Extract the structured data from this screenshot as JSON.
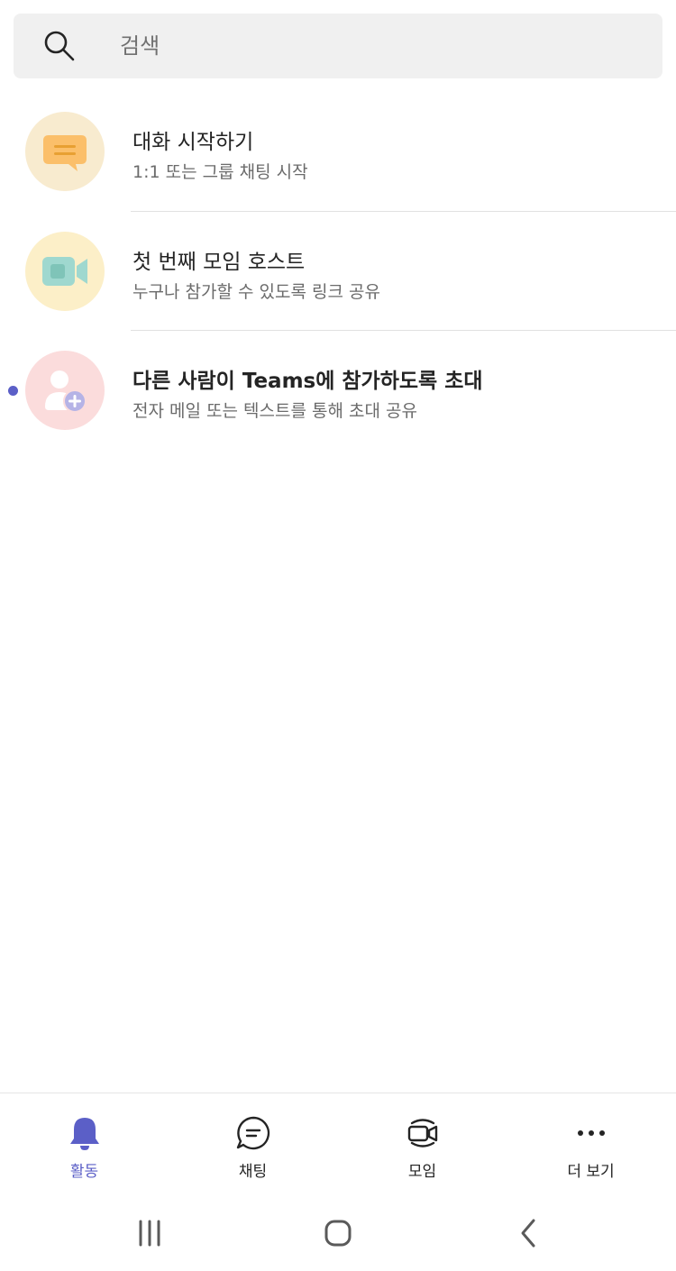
{
  "search": {
    "placeholder": "검색"
  },
  "items": [
    {
      "title": "대화 시작하기",
      "subtitle": "1:1 또는 그룹 채팅 시작",
      "icon": "chat-bubble-icon",
      "avatar_color": "#f8ebcf"
    },
    {
      "title": "첫 번째 모임 호스트",
      "subtitle": "누구나 참가할 수 있도록 링크 공유",
      "icon": "video-camera-icon",
      "avatar_color": "#fcefc8"
    },
    {
      "title": "다른 사람이 Teams에 참가하도록 초대",
      "subtitle": "전자 메일 또는 텍스트를 통해 초대 공유",
      "icon": "add-person-icon",
      "avatar_color": "#fbdcdc",
      "unread": true
    }
  ],
  "nav": {
    "tabs": [
      {
        "label": "활동",
        "icon": "bell-icon",
        "active": true
      },
      {
        "label": "채팅",
        "icon": "chat-icon",
        "active": false
      },
      {
        "label": "모임",
        "icon": "meeting-icon",
        "active": false
      },
      {
        "label": "더 보기",
        "icon": "more-icon",
        "active": false
      }
    ]
  },
  "system_nav": [
    "recents-icon",
    "home-icon",
    "back-icon"
  ],
  "colors": {
    "accent": "#5b5fc7",
    "search_bg": "#f0f0f0"
  }
}
